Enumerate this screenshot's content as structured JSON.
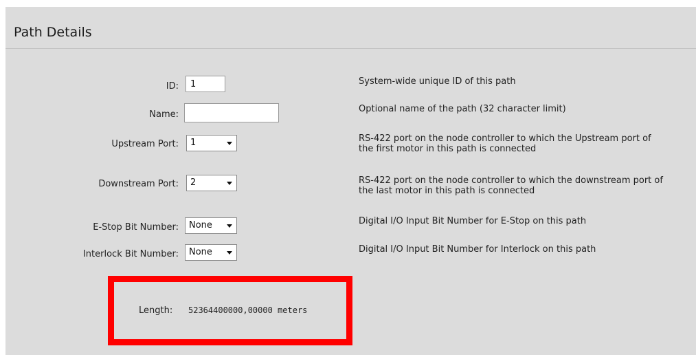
{
  "panel": {
    "title": "Path Details"
  },
  "fields": {
    "id": {
      "label": "ID:",
      "value": "1",
      "description": "System-wide unique ID of this path"
    },
    "name": {
      "label": "Name:",
      "value": "",
      "description": "Optional name of the path (32 character limit)"
    },
    "upstream_port": {
      "label": "Upstream Port:",
      "selected": "1",
      "description_line1": "RS-422 port on the node controller to which the Upstream port of",
      "description_line2": "the first motor in this path is connected"
    },
    "downstream_port": {
      "label": "Downstream Port:",
      "selected": "2",
      "description_line1": "RS-422 port on the node controller to which the downstream port of",
      "description_line2": "the last motor in this path is connected"
    },
    "estop_bit": {
      "label": "E-Stop Bit Number:",
      "selected": "None",
      "description": "Digital I/O Input Bit Number for E-Stop on this path"
    },
    "interlock_bit": {
      "label": "Interlock Bit Number:",
      "selected": "None",
      "description": "Digital I/O Input Bit Number for Interlock on this path"
    }
  },
  "length": {
    "label": "Length:",
    "value": "52364400000,00000 meters"
  },
  "colors": {
    "panel_bg": "#dcdcdc",
    "highlight": "#ff0000"
  }
}
